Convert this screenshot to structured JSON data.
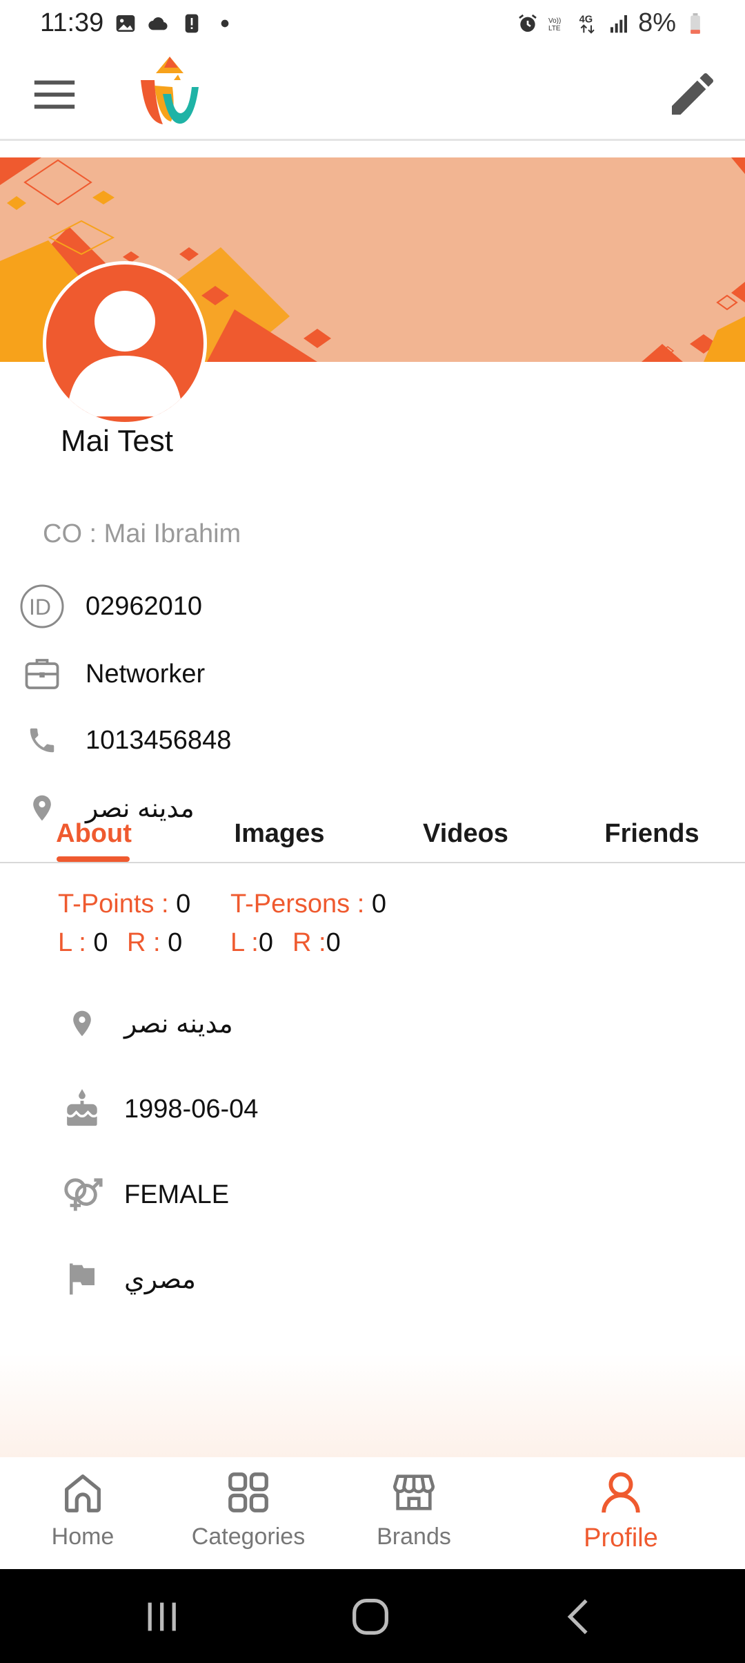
{
  "status_bar": {
    "time": "11:39",
    "battery": "8%",
    "left_icons": [
      "image-icon",
      "cloud-icon",
      "alert-icon",
      "dot-icon"
    ],
    "right_icons": [
      "alarm-icon",
      "volte-icon",
      "4g-icon",
      "signal-icon",
      "battery-icon"
    ]
  },
  "app_bar": {
    "menu_icon": "hamburger-menu-icon",
    "logo": "app-logo",
    "edit_icon": "pencil-edit-icon"
  },
  "profile": {
    "name": "Mai Test",
    "co": "CO : Mai Ibrahim",
    "details": [
      {
        "icon": "id-icon",
        "value": "02962010"
      },
      {
        "icon": "briefcase-icon",
        "value": "Networker"
      },
      {
        "icon": "phone-icon",
        "value": "1013456848"
      },
      {
        "icon": "location-pin-icon",
        "value": "مدينه نصر"
      }
    ]
  },
  "tabs": [
    {
      "label": "About",
      "active": true
    },
    {
      "label": "Images",
      "active": false
    },
    {
      "label": "Videos",
      "active": false
    },
    {
      "label": "Friends",
      "active": false
    }
  ],
  "points": {
    "t_points_label": "T-Points : ",
    "t_points_value": "0",
    "t_persons_label": "T-Persons : ",
    "t_persons_value": "0",
    "left_l_label": "L : ",
    "left_l_value": "0",
    "left_r_label": "R : ",
    "left_r_value": "0",
    "right_l_label": "L :",
    "right_l_value": "0",
    "right_r_label": "R :",
    "right_r_value": "0"
  },
  "about": [
    {
      "icon": "location-pin-icon",
      "value": "مدينه نصر"
    },
    {
      "icon": "birthday-cake-icon",
      "value": "1998-06-04"
    },
    {
      "icon": "gender-icon",
      "value": "FEMALE"
    },
    {
      "icon": "flag-icon",
      "value": "مصري"
    }
  ],
  "bottom_nav": [
    {
      "label": "Home",
      "icon": "home-icon",
      "active": false
    },
    {
      "label": "Categories",
      "icon": "categories-grid-icon",
      "active": false
    },
    {
      "label": "Brands",
      "icon": "store-icon",
      "active": false
    },
    {
      "label": "Profile",
      "icon": "person-icon",
      "active": true
    }
  ],
  "colors": {
    "accent": "#ef5a2f",
    "cover": "#f2b592",
    "icon_gray": "#8a8a8a"
  }
}
